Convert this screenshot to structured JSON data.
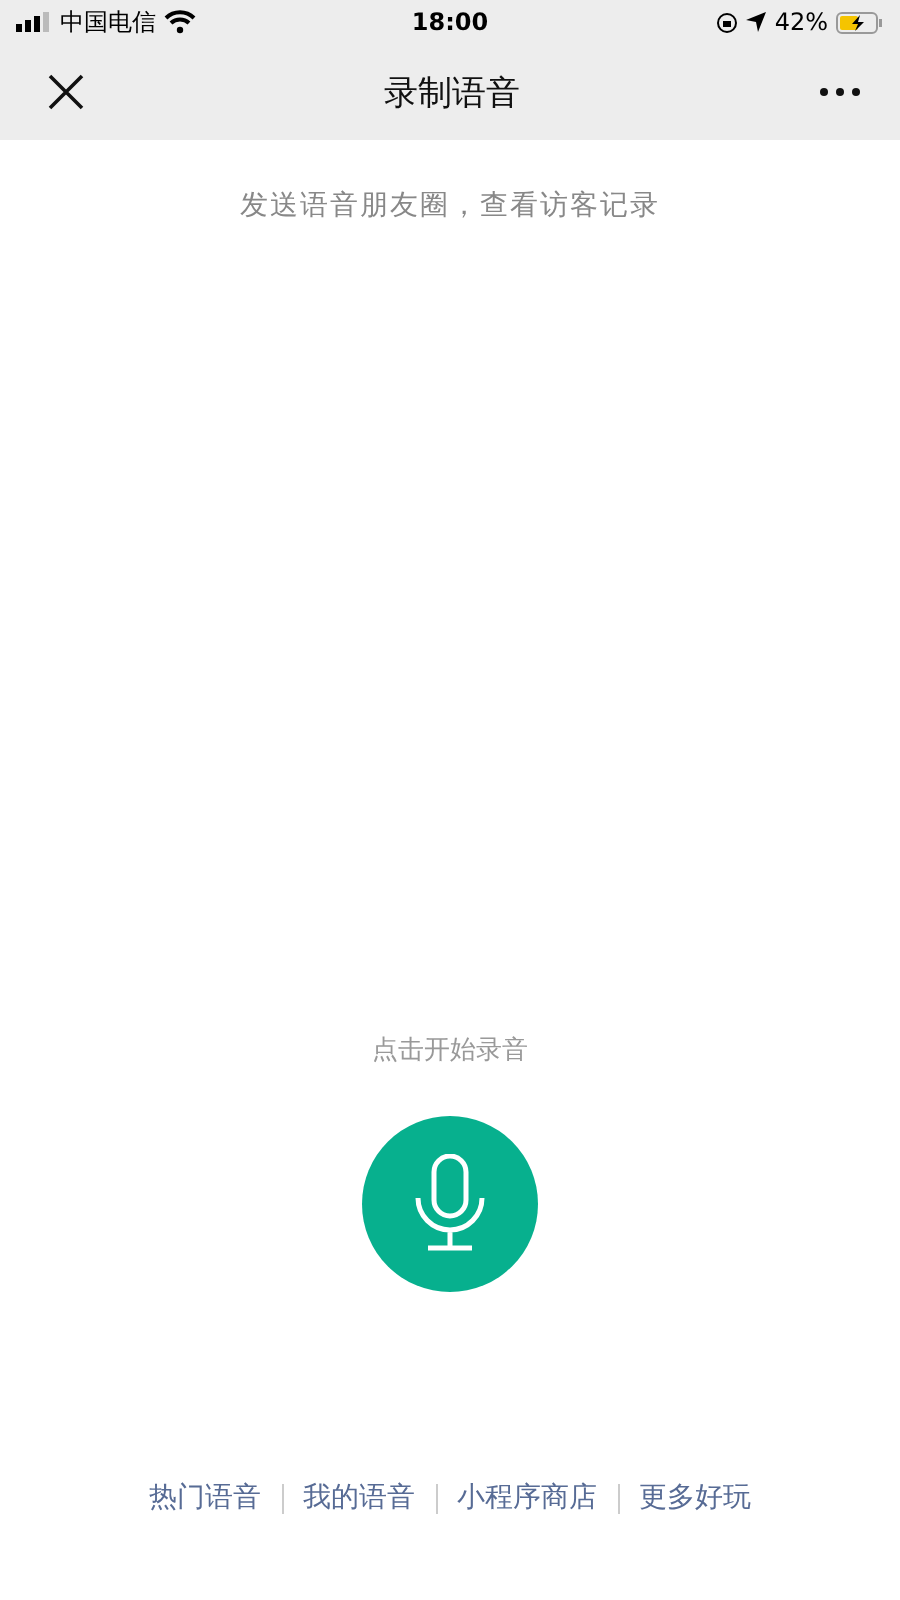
{
  "status_bar": {
    "carrier": "中国电信",
    "time": "18:00",
    "battery": "42%"
  },
  "nav_bar": {
    "title": "录制语音"
  },
  "subtitle": "发送语音朋友圈，查看访客记录",
  "record": {
    "hint": "点击开始录音"
  },
  "footer_links": [
    {
      "label": "热门语音"
    },
    {
      "label": "我的语音"
    },
    {
      "label": "小程序商店"
    },
    {
      "label": "更多好玩"
    }
  ]
}
